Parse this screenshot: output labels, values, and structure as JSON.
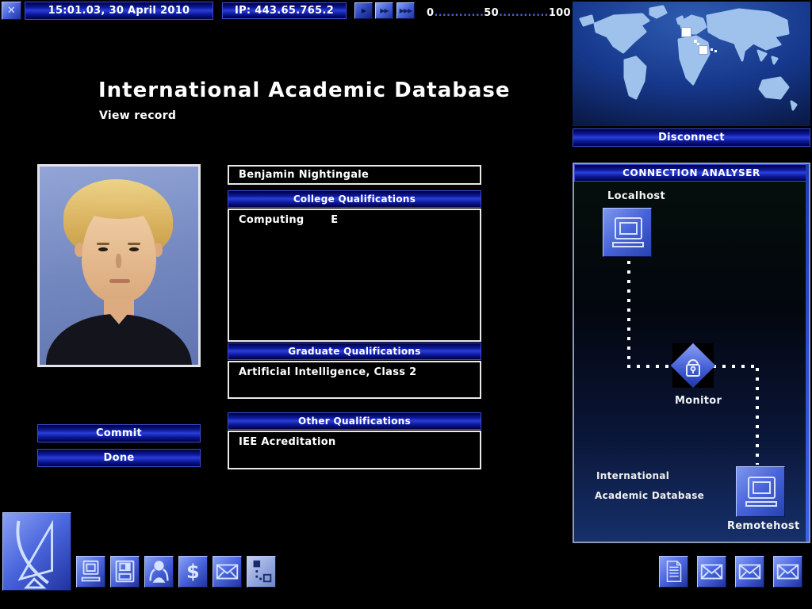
{
  "topbar": {
    "close_glyph": "✕",
    "datetime": "15:01.03, 30 April 2010",
    "ip": "IP: 443.65.765.2",
    "speed_buttons": [
      "▶",
      "▶▶",
      "▶▶▶"
    ],
    "cpu_scale": {
      "start": "0",
      "mid": "50",
      "end": "100",
      "dots1": "............",
      "dots2": "............"
    }
  },
  "page": {
    "title": "International Academic Database",
    "subtitle": "View record"
  },
  "record": {
    "name": "Benjamin Nightingale",
    "sections": [
      {
        "header": "College Qualifications",
        "content": "Computing       E"
      },
      {
        "header": "Graduate Qualifications",
        "content": "Artificial Intelligence, Class 2"
      },
      {
        "header": "Other Qualifications",
        "content": "IEE Acreditation"
      }
    ],
    "commit_label": "Commit",
    "done_label": "Done"
  },
  "map": {
    "disconnect_label": "Disconnect"
  },
  "analyser": {
    "title": "CONNECTION ANALYSER",
    "localhost_label": "Localhost",
    "monitor_label": "Monitor",
    "remote_name_line1": "International",
    "remote_name_line2": "Academic Database",
    "remotehost_label": "Remotehost"
  },
  "toolbar": {
    "dollar_glyph": "$",
    "left_icons": [
      "computer-icon",
      "floppy-disk-icon",
      "person-icon",
      "dollar-icon",
      "envelope-icon",
      "lan-icon"
    ],
    "right_icons": [
      "news-document-icon",
      "envelope-icon",
      "envelope-icon",
      "envelope-icon"
    ]
  },
  "colors": {
    "accent_blue": "#2b3fd8",
    "panel_dark": "#000042",
    "map_land": "#9fc2ec",
    "map_sea": "#123a8a",
    "text": "#ffffff"
  }
}
